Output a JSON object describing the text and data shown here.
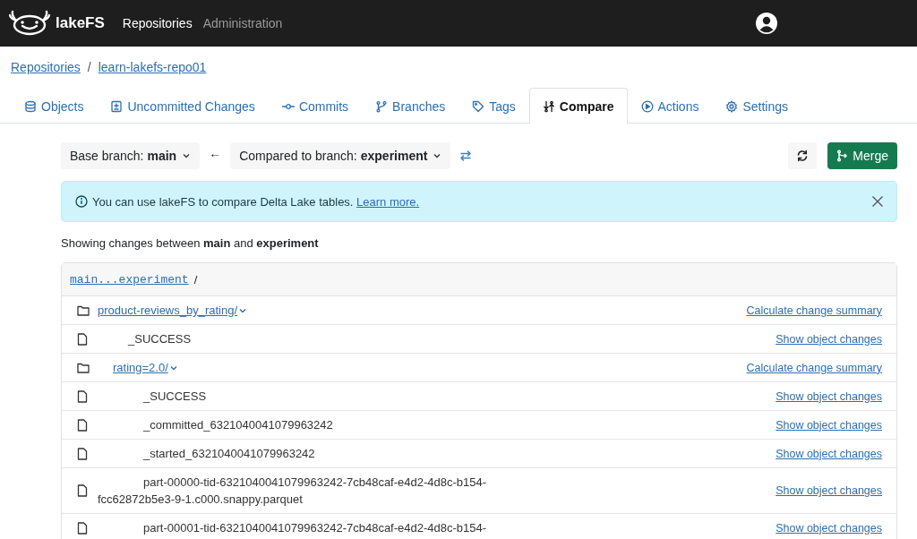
{
  "navbar": {
    "brand": "lakeFS",
    "links": [
      {
        "label": "Repositories",
        "selected": true
      },
      {
        "label": "Administration",
        "selected": false
      }
    ]
  },
  "breadcrumb": [
    "Repositories",
    "learn-lakefs-repo01"
  ],
  "breadcrumb_separator": "/",
  "tabs": [
    {
      "label": "Objects",
      "selected": false
    },
    {
      "label": "Uncommitted Changes",
      "selected": false
    },
    {
      "label": "Commits",
      "selected": false
    },
    {
      "label": "Branches",
      "selected": false
    },
    {
      "label": "Tags",
      "selected": false
    },
    {
      "label": "Compare",
      "selected": true
    },
    {
      "label": "Actions",
      "selected": false
    },
    {
      "label": "Settings",
      "selected": false
    }
  ],
  "compare": {
    "base_label": "Base branch: ",
    "base": "main",
    "arrow": "←",
    "compared_label": "Compared to branch: ",
    "compared": "experiment",
    "merge_button": "Merge"
  },
  "alert": {
    "text": "You can use lakeFS to compare Delta Lake tables. ",
    "link": "Learn more."
  },
  "summary": "Showing changes between **main** and **experiment**",
  "tree": {
    "path": "main...experiment",
    "separator": "/",
    "items": [
      {
        "kind": "folder",
        "name": "product-reviews_by_rating/",
        "expanded": true,
        "action": "Calculate change summary",
        "children": [
          {
            "kind": "file",
            "name": "_SUCCESS",
            "action": "Show object changes"
          },
          {
            "kind": "folder",
            "name": "rating=2.0/",
            "expanded": true,
            "action": "Calculate change summary",
            "children": [
              {
                "kind": "file",
                "name": "_SUCCESS",
                "action": "Show object changes"
              },
              {
                "kind": "file",
                "name": "_committed_6321040041079963242",
                "action": "Show object changes"
              },
              {
                "kind": "file",
                "name": "_started_6321040041079963242",
                "action": "Show object changes"
              },
              {
                "kind": "file",
                "name": "part-00000-tid-6321040041079963242-7cb48caf-e4d2-4d8c-b154-fcc62872b5e3-9-1.c000.snappy.parquet",
                "action": "Show object changes"
              },
              {
                "kind": "file",
                "name": "part-00001-tid-6321040041079963242-7cb48caf-e4d2-4d8c-b154-",
                "action": "Show object changes"
              }
            ]
          }
        ]
      }
    ]
  }
}
